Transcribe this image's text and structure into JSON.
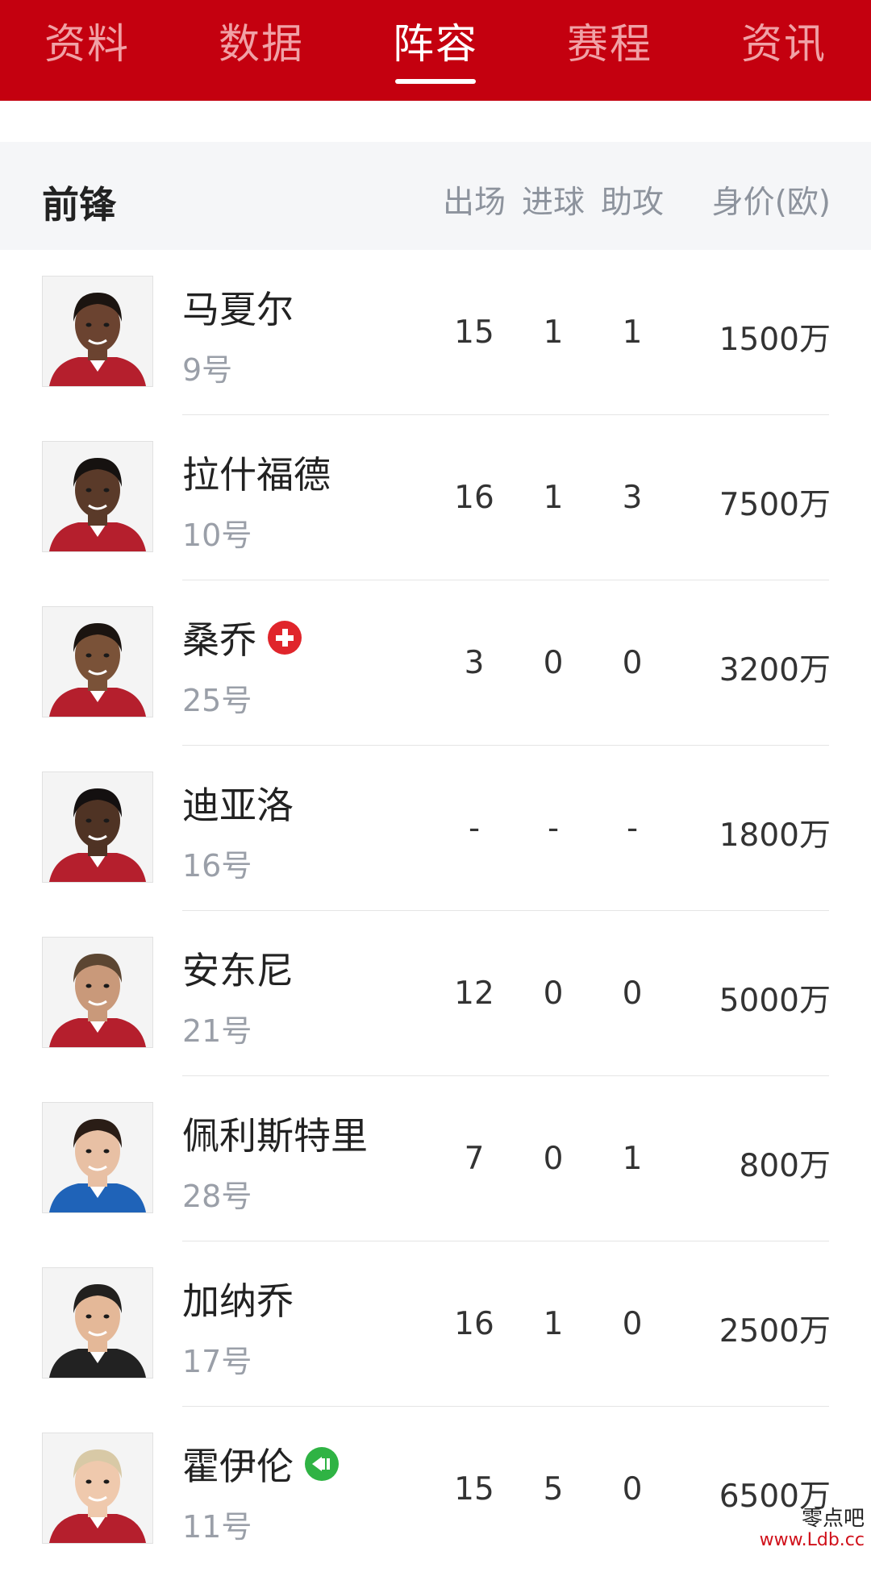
{
  "tabs": [
    {
      "label": "资料",
      "active": false
    },
    {
      "label": "数据",
      "active": false
    },
    {
      "label": "阵容",
      "active": true
    },
    {
      "label": "赛程",
      "active": false
    },
    {
      "label": "资讯",
      "active": false
    }
  ],
  "section": {
    "title": "前锋",
    "columns": {
      "apps": "出场",
      "goals": "进球",
      "assists": "助攻",
      "value": "身价(欧)"
    }
  },
  "players": [
    {
      "name": "马夏尔",
      "number": "9号",
      "apps": "15",
      "goals": "1",
      "assists": "1",
      "value": "1500万",
      "badge": "",
      "skin": "#6b4330",
      "hair": "#1b1410",
      "kit": "#b51f2d"
    },
    {
      "name": "拉什福德",
      "number": "10号",
      "apps": "16",
      "goals": "1",
      "assists": "3",
      "value": "7500万",
      "badge": "",
      "skin": "#5a3a29",
      "hair": "#161210",
      "kit": "#b51f2d"
    },
    {
      "name": "桑乔",
      "number": "25号",
      "apps": "3",
      "goals": "0",
      "assists": "0",
      "value": "3200万",
      "badge": "injury",
      "skin": "#7a5238",
      "hair": "#1b1410",
      "kit": "#b51f2d"
    },
    {
      "name": "迪亚洛",
      "number": "16号",
      "apps": "-",
      "goals": "-",
      "assists": "-",
      "value": "1800万",
      "badge": "",
      "skin": "#4f3324",
      "hair": "#141010",
      "kit": "#b51f2d"
    },
    {
      "name": "安东尼",
      "number": "21号",
      "apps": "12",
      "goals": "0",
      "assists": "0",
      "value": "5000万",
      "badge": "",
      "skin": "#c9997a",
      "hair": "#5c4632",
      "kit": "#b51f2d"
    },
    {
      "name": "佩利斯特里",
      "number": "28号",
      "apps": "7",
      "goals": "0",
      "assists": "1",
      "value": "800万",
      "badge": "",
      "skin": "#e8c0a4",
      "hair": "#2a1d16",
      "kit": "#1f63b8"
    },
    {
      "name": "加纳乔",
      "number": "17号",
      "apps": "16",
      "goals": "1",
      "assists": "0",
      "value": "2500万",
      "badge": "",
      "skin": "#e4b898",
      "hair": "#22201e",
      "kit": "#222222"
    },
    {
      "name": "霍伊伦",
      "number": "11号",
      "apps": "15",
      "goals": "5",
      "assists": "0",
      "value": "6500万",
      "badge": "sub",
      "skin": "#efc9ad",
      "hair": "#d8c9a6",
      "kit": "#b51f2d"
    }
  ],
  "watermark": {
    "name": "零点吧",
    "url": "www.Ldb.cc"
  },
  "colors": {
    "brand_red": "#c4000f",
    "header_bg": "#f5f6f8",
    "injury_red": "#e0252b",
    "sub_green": "#2fb344"
  }
}
